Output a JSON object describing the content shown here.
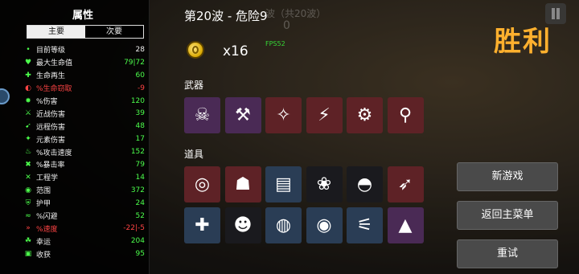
{
  "stats_panel": {
    "title": "属性",
    "tabs": [
      {
        "label": "主要",
        "active": true
      },
      {
        "label": "次要",
        "active": false
      }
    ],
    "rows": [
      {
        "icon": "•",
        "name": "目前等级",
        "value": "28",
        "color": "white"
      },
      {
        "icon": "♥",
        "name": "最大生命值",
        "value": "79|72",
        "color": "green"
      },
      {
        "icon": "✚",
        "name": "生命再生",
        "value": "60",
        "color": "green"
      },
      {
        "icon": "◐",
        "name": "%生命窃取",
        "value": "-9",
        "color": "red"
      },
      {
        "icon": "✸",
        "name": "%伤害",
        "value": "120",
        "color": "green"
      },
      {
        "icon": "⚔",
        "name": "近战伤害",
        "value": "39",
        "color": "green"
      },
      {
        "icon": "➹",
        "name": "远程伤害",
        "value": "48",
        "color": "green"
      },
      {
        "icon": "✦",
        "name": "元素伤害",
        "value": "17",
        "color": "green"
      },
      {
        "icon": "♨",
        "name": "%攻击速度",
        "value": "152",
        "color": "green"
      },
      {
        "icon": "✖",
        "name": "%暴击率",
        "value": "79",
        "color": "green"
      },
      {
        "icon": "✕",
        "name": "工程学",
        "value": "14",
        "color": "green"
      },
      {
        "icon": "◉",
        "name": "范围",
        "value": "372",
        "color": "green"
      },
      {
        "icon": "⛨",
        "name": "护甲",
        "value": "24",
        "color": "green"
      },
      {
        "icon": "≈",
        "name": "%闪避",
        "value": "52",
        "color": "green"
      },
      {
        "icon": "»",
        "name": "%速度",
        "value": "-22|-5",
        "color": "red"
      },
      {
        "icon": "☘",
        "name": "幸运",
        "value": "204",
        "color": "green"
      },
      {
        "icon": "▣",
        "name": "收获",
        "value": "95",
        "color": "green"
      }
    ]
  },
  "header": {
    "wave_title": "第20波 - 危险9",
    "ghost_wave": "波（共20波）",
    "ghost_count": "0",
    "fps": "FPS52"
  },
  "materials": {
    "icon": "gold-coin-icon",
    "count": "x16"
  },
  "weapons": {
    "label": "武器",
    "items": [
      {
        "name": "skull-staff-icon",
        "glyph": "☠",
        "bg": "purple"
      },
      {
        "name": "hammer-weapon-icon",
        "glyph": "⚒",
        "bg": "purple"
      },
      {
        "name": "shuriken-icon",
        "glyph": "✧",
        "bg": "red"
      },
      {
        "name": "taser-gun-icon",
        "glyph": "⚡",
        "bg": "red"
      },
      {
        "name": "minigun-icon",
        "glyph": "⚙",
        "bg": "red"
      },
      {
        "name": "wrench-gun-icon",
        "glyph": "⚲",
        "bg": "red"
      }
    ]
  },
  "items": {
    "label": "道具",
    "row1": [
      {
        "name": "binoculars-icon",
        "glyph": "◎",
        "bg": "red"
      },
      {
        "name": "mammoth-icon",
        "glyph": "☗",
        "bg": "red"
      },
      {
        "name": "scarf-icon",
        "glyph": "▤",
        "bg": "blue"
      },
      {
        "name": "red-ribbon-icon",
        "glyph": "❀",
        "bg": "dark"
      },
      {
        "name": "beanie-hat-icon",
        "glyph": "◓",
        "bg": "dark"
      },
      {
        "name": "bullet-icon",
        "glyph": "➶",
        "bg": "red"
      }
    ],
    "row2": [
      {
        "name": "medic-robot-icon",
        "glyph": "✚",
        "bg": "blue"
      },
      {
        "name": "bee-icon",
        "glyph": "☻",
        "bg": "dark"
      },
      {
        "name": "diver-helmet-icon",
        "glyph": "◍",
        "bg": "blue"
      },
      {
        "name": "golden-coin-icon",
        "glyph": "◉",
        "bg": "blue"
      },
      {
        "name": "claw-strike-icon",
        "glyph": "⚟",
        "bg": "blue"
      },
      {
        "name": "rocket-icon",
        "glyph": "▲",
        "bg": "purple"
      }
    ]
  },
  "result": {
    "title": "胜利"
  },
  "menu": {
    "new_game": "新游戏",
    "main_menu": "返回主菜单",
    "retry": "重试"
  },
  "colors": {
    "victory": "#ffb02e",
    "positive": "#4cff4c",
    "negative": "#ff4444",
    "fps": "#36d836"
  }
}
